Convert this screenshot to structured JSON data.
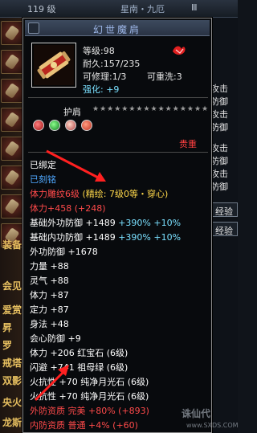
{
  "background": {
    "top_left_text": "119 级",
    "top_center_text": "星南・九厄",
    "top_right_text": "Ⅲ",
    "left_labels": [
      "装备",
      "会见",
      "爱赏",
      "昇",
      "罗",
      "戒塔",
      "双影",
      "央火",
      "龙斯"
    ],
    "right_items": [
      "攻击",
      "防御",
      "攻击",
      "防御",
      "攻击",
      "防御",
      "攻击",
      "防御"
    ],
    "right_boxes": [
      "经验",
      "经验"
    ]
  },
  "tooltip": {
    "title": "幻世魔肩",
    "level": "等级:98",
    "durability": "耐久:157/235",
    "repairable": "可修理:1/3",
    "rewash": "可重洗:3",
    "strengthen_label": "强化:",
    "strengthen_value": "+9",
    "slot": "护肩",
    "stars": "★★★★★★★★★★★★★★★★",
    "rarity": "贵重",
    "bound": "已绑定",
    "engraved": "已刻铭",
    "seal_name": "体力雕纹6级",
    "seal_detail": "(精绘: 7级0等・穿心)",
    "stats": [
      {
        "base": "体力+458",
        "extra": "(+248)"
      },
      {
        "base": "基础外功防御 +1489",
        "extra": "+390% +10%"
      },
      {
        "base": "基础内功防御 +1489",
        "extra": "+390% +10%"
      },
      {
        "base": "外功防御 +1678",
        "extra": ""
      },
      {
        "base": "力量 +88",
        "extra": ""
      },
      {
        "base": "灵气 +88",
        "extra": ""
      },
      {
        "base": "体力 +87",
        "extra": ""
      },
      {
        "base": "定力 +87",
        "extra": ""
      },
      {
        "base": "身法 +48",
        "extra": ""
      },
      {
        "base": "会心防御 +9",
        "extra": ""
      },
      {
        "base": "体力 +206",
        "extra": "红宝石 (6级)"
      },
      {
        "base": "闪避 +741",
        "extra": "祖母绿 (6级)"
      },
      {
        "base": "火抗性 +70",
        "extra": "纯净月光石 (6级)"
      },
      {
        "base": "火抗性 +70",
        "extra": "纯净月光石 (6级)"
      },
      {
        "base": "外防资质",
        "extra": "完美 +80% (+893)"
      },
      {
        "base": "内防资质",
        "extra": "普通 +4% (+60)"
      }
    ]
  },
  "watermark": {
    "name": "诛仙代",
    "url": "www.SXDS.COM"
  },
  "colors": {
    "bound": "#ffffff",
    "engraved": "#4fa8ff",
    "seal": "#ff4a4a",
    "rarity": "#ff4040"
  }
}
